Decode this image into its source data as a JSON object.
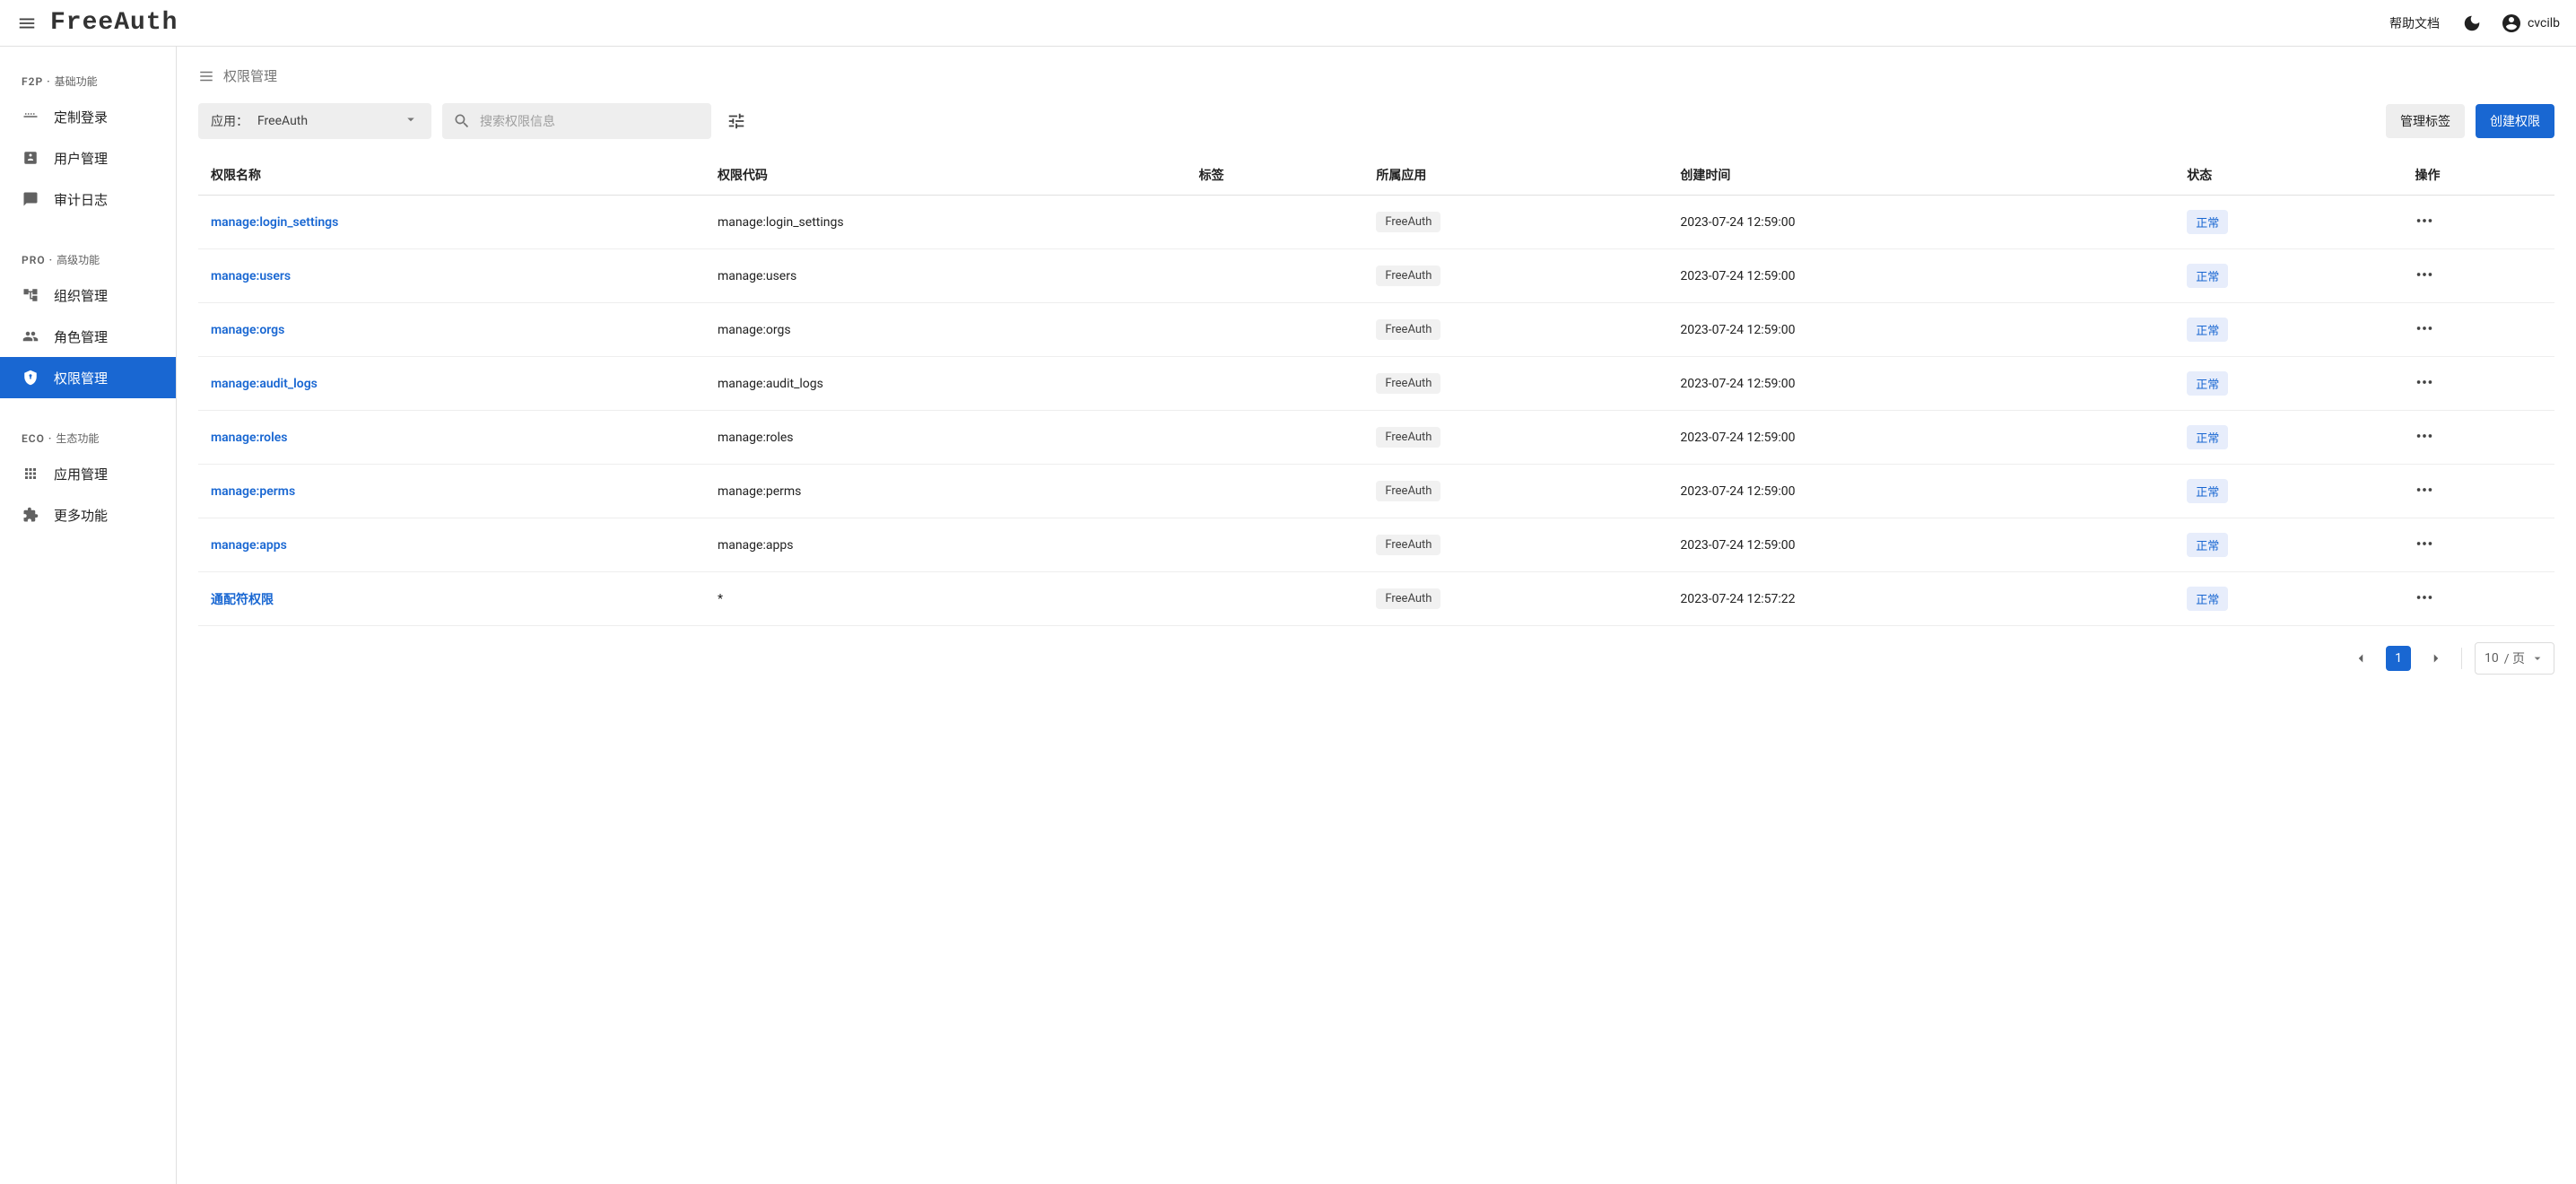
{
  "header": {
    "logo": "FreeAuth",
    "help_link": "帮助文档",
    "username": "cvcilb"
  },
  "sidebar": {
    "sections": [
      {
        "key": "f2p",
        "code": "F2P",
        "label": "基础功能"
      },
      {
        "key": "pro",
        "code": "PRO",
        "label": "高级功能"
      },
      {
        "key": "eco",
        "code": "ECO",
        "label": "生态功能"
      }
    ],
    "items": {
      "f2p": [
        {
          "key": "custom-login",
          "label": "定制登录"
        },
        {
          "key": "user-mgmt",
          "label": "用户管理"
        },
        {
          "key": "audit-log",
          "label": "审计日志"
        }
      ],
      "pro": [
        {
          "key": "org-mgmt",
          "label": "组织管理"
        },
        {
          "key": "role-mgmt",
          "label": "角色管理"
        },
        {
          "key": "perm-mgmt",
          "label": "权限管理"
        }
      ],
      "eco": [
        {
          "key": "app-mgmt",
          "label": "应用管理"
        },
        {
          "key": "more",
          "label": "更多功能"
        }
      ]
    },
    "active": "perm-mgmt"
  },
  "page": {
    "title": "权限管理",
    "app_filter_label": "应用：",
    "app_filter_value": "FreeAuth",
    "search_placeholder": "搜索权限信息",
    "manage_tags_btn": "管理标签",
    "create_perm_btn": "创建权限"
  },
  "table": {
    "columns": {
      "name": "权限名称",
      "code": "权限代码",
      "tag": "标签",
      "app": "所属应用",
      "created": "创建时间",
      "status": "状态",
      "ops": "操作"
    },
    "rows": [
      {
        "name": "manage:login_settings",
        "code": "manage:login_settings",
        "tag": "",
        "app": "FreeAuth",
        "created": "2023-07-24 12:59:00",
        "status": "正常"
      },
      {
        "name": "manage:users",
        "code": "manage:users",
        "tag": "",
        "app": "FreeAuth",
        "created": "2023-07-24 12:59:00",
        "status": "正常"
      },
      {
        "name": "manage:orgs",
        "code": "manage:orgs",
        "tag": "",
        "app": "FreeAuth",
        "created": "2023-07-24 12:59:00",
        "status": "正常"
      },
      {
        "name": "manage:audit_logs",
        "code": "manage:audit_logs",
        "tag": "",
        "app": "FreeAuth",
        "created": "2023-07-24 12:59:00",
        "status": "正常"
      },
      {
        "name": "manage:roles",
        "code": "manage:roles",
        "tag": "",
        "app": "FreeAuth",
        "created": "2023-07-24 12:59:00",
        "status": "正常"
      },
      {
        "name": "manage:perms",
        "code": "manage:perms",
        "tag": "",
        "app": "FreeAuth",
        "created": "2023-07-24 12:59:00",
        "status": "正常"
      },
      {
        "name": "manage:apps",
        "code": "manage:apps",
        "tag": "",
        "app": "FreeAuth",
        "created": "2023-07-24 12:59:00",
        "status": "正常"
      },
      {
        "name": "通配符权限",
        "code": "*",
        "tag": "",
        "app": "FreeAuth",
        "created": "2023-07-24 12:57:22",
        "status": "正常"
      }
    ]
  },
  "pagination": {
    "current": "1",
    "page_size": "10",
    "page_size_suffix": "/ 页"
  }
}
